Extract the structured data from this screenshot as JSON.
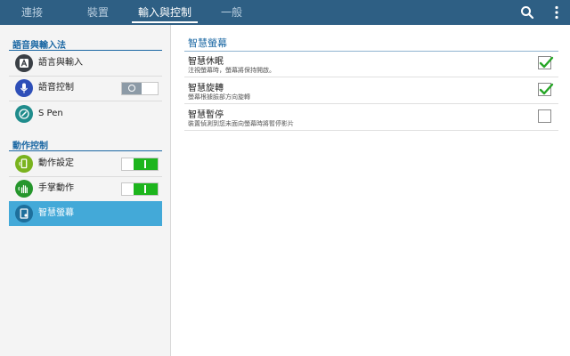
{
  "topbar": {
    "tabs": [
      {
        "label": "連接"
      },
      {
        "label": "裝置"
      },
      {
        "label": "輸入與控制"
      },
      {
        "label": "一般"
      }
    ],
    "active_tab": "輸入與控制"
  },
  "sidebar": {
    "sections": [
      {
        "header": "語音與輸入法",
        "items": [
          {
            "label": "語言與輸入",
            "icon": "keyboard-a-icon"
          },
          {
            "label": "語音控制",
            "icon": "microphone-icon",
            "toggle": "off"
          },
          {
            "label": "S Pen",
            "icon": "s-pen-icon"
          }
        ]
      },
      {
        "header": "動作控制",
        "items": [
          {
            "label": "動作設定",
            "icon": "motion-phone-icon",
            "toggle": "on"
          },
          {
            "label": "手掌動作",
            "icon": "palm-motion-icon",
            "toggle": "on"
          },
          {
            "label": "智慧螢幕",
            "icon": "smart-screen-icon",
            "selected": true
          }
        ]
      }
    ]
  },
  "main": {
    "title": "智慧螢幕",
    "settings": [
      {
        "title": "智慧休眠",
        "subtitle": "注視螢幕時，螢幕將保持開啟。",
        "checked": true
      },
      {
        "title": "智慧旋轉",
        "subtitle": "螢幕根據臉部方向旋轉",
        "checked": true
      },
      {
        "title": "智慧暫停",
        "subtitle": "裝置偵測到您未面向螢幕時將暫停影片",
        "checked": false
      }
    ]
  },
  "colors": {
    "topbar": "#2e5f84",
    "accent": "#1a67a3",
    "selected": "#43a9d8",
    "toggle_on": "#1db51d",
    "check": "#26a626"
  }
}
